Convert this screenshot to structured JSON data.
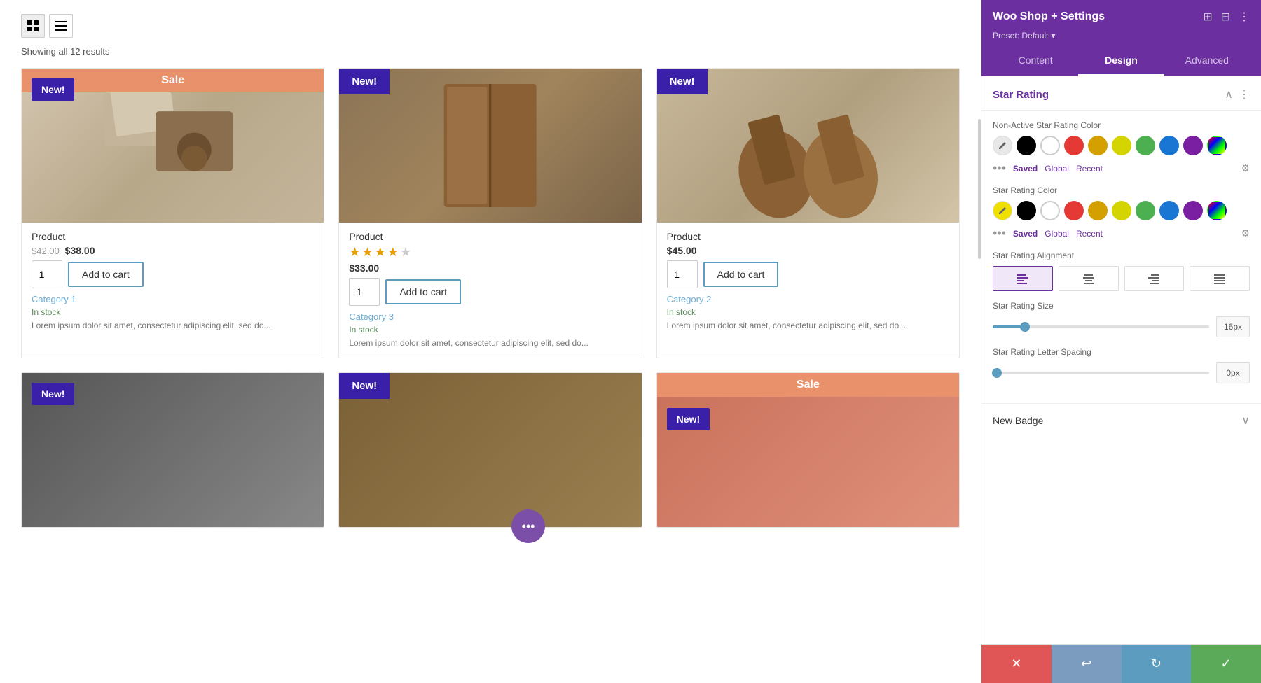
{
  "shop": {
    "toolbar": {
      "grid_icon": "⊞",
      "list_icon": "≡"
    },
    "results_text": "Showing all 12 results",
    "products": [
      {
        "id": 1,
        "badge_type": "sale",
        "badge_label": "Sale",
        "badge_new_label": "New!",
        "name": "Product",
        "price_original": "$42.00",
        "price_sale": "$38.00",
        "has_sale_price": true,
        "has_stars": false,
        "category": "Category 1",
        "stock": "In stock",
        "description": "Lorem ipsum dolor sit amet, consectetur adipiscing elit, sed do...",
        "add_to_cart": "Add to cart",
        "qty": "1"
      },
      {
        "id": 2,
        "badge_type": "new_corner",
        "badge_label": "New!",
        "name": "Product",
        "price": "$33.00",
        "has_sale_price": false,
        "has_stars": true,
        "stars_filled": 4,
        "stars_empty": 1,
        "category": "Category 3",
        "stock": "In stock",
        "description": "Lorem ipsum dolor sit amet, consectetur adipiscing elit, sed do...",
        "add_to_cart": "Add to cart",
        "qty": "1"
      },
      {
        "id": 3,
        "badge_type": "new_corner",
        "badge_label": "New!",
        "name": "Product",
        "price": "$45.00",
        "has_sale_price": false,
        "has_stars": false,
        "category": "Category 2",
        "stock": "In stock",
        "description": "Lorem ipsum dolor sit amet, consectetur adipiscing elit, sed do...",
        "add_to_cart": "Add to cart",
        "qty": "1"
      }
    ],
    "bottom_products": [
      {
        "badge_type": "new",
        "badge_label": "New!"
      },
      {
        "badge_type": "new",
        "badge_label": "New!"
      },
      {
        "badge_type": "sale",
        "badge_label": "Sale",
        "badge_new_label": "New!"
      }
    ],
    "floating_dots": "•••"
  },
  "panel": {
    "title": "Woo Shop + Settings",
    "preset_label": "Preset: Default",
    "tabs": [
      {
        "id": "content",
        "label": "Content"
      },
      {
        "id": "design",
        "label": "Design"
      },
      {
        "id": "advanced",
        "label": "Advanced"
      }
    ],
    "active_tab": "design",
    "star_rating_section": {
      "title": "Star Rating",
      "non_active_label": "Non-Active Star Rating Color",
      "active_label": "Star Rating Color",
      "colors": [
        {
          "hex": "#000000",
          "label": "Black"
        },
        {
          "hex": "#ffffff",
          "label": "White"
        },
        {
          "hex": "#e53935",
          "label": "Red"
        },
        {
          "hex": "#d4a000",
          "label": "Gold"
        },
        {
          "hex": "#d4d400",
          "label": "Yellow"
        },
        {
          "hex": "#4caf50",
          "label": "Green"
        },
        {
          "hex": "#1976d2",
          "label": "Blue"
        },
        {
          "hex": "#7b1fa2",
          "label": "Purple"
        }
      ],
      "color_tabs": [
        "Saved",
        "Global",
        "Recent"
      ],
      "active_color_tab": "Saved",
      "alignment_label": "Star Rating Alignment",
      "alignment_options": [
        "left",
        "center",
        "right",
        "justify"
      ],
      "size_label": "Star Rating Size",
      "size_value": "16px",
      "size_percent": 15,
      "letter_spacing_label": "Star Rating Letter Spacing",
      "letter_spacing_value": "0px",
      "letter_spacing_percent": 2
    },
    "new_badge_section": {
      "title": "New Badge"
    },
    "bottom_actions": {
      "cancel": "✕",
      "undo": "↩",
      "redo": "↻",
      "save": "✓"
    }
  }
}
